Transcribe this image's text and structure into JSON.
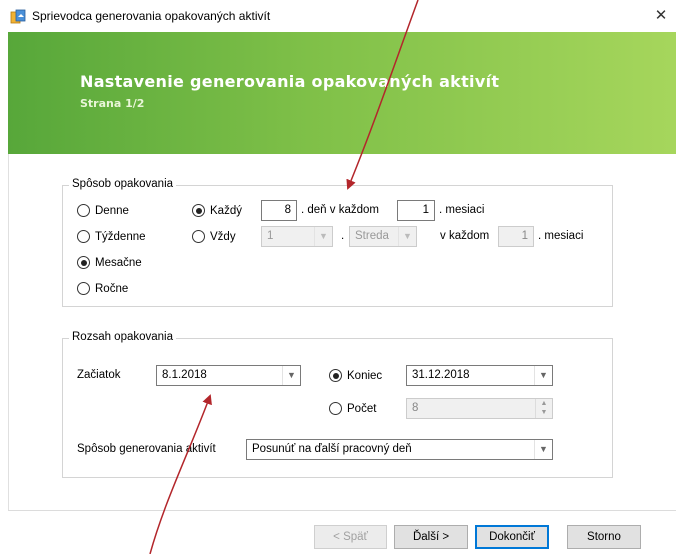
{
  "window": {
    "title": "Sprievodca generovania opakovaných aktivít",
    "close_symbol": "✕"
  },
  "banner": {
    "title": "Nastavenie generovania opakovaných aktivít",
    "subtitle": "Strana 1/2"
  },
  "repeat_mode": {
    "legend": "Spôsob opakovania",
    "options": [
      {
        "label": "Denne",
        "selected": false
      },
      {
        "label": "Týždenne",
        "selected": false
      },
      {
        "label": "Mesačne",
        "selected": true
      },
      {
        "label": "Ročne",
        "selected": false
      }
    ],
    "each": {
      "label": "Každý",
      "selected": true,
      "day_value": "8",
      "day_text": ". deň v každom",
      "month_value": "1",
      "month_text": ". mesiaci"
    },
    "always": {
      "label": "Vždy",
      "selected": false,
      "order_value": "1",
      "dot": ".",
      "weekday_value": "Streda",
      "in_each_text": "v každom",
      "month_value": "1",
      "month_text": ". mesiaci"
    }
  },
  "range": {
    "legend": "Rozsah opakovania",
    "start_label": "Začiatok",
    "start_value": "8.1.2018",
    "end": {
      "label": "Koniec",
      "selected": true,
      "value": "31.12.2018"
    },
    "count": {
      "label": "Počet",
      "selected": false,
      "value": "8"
    },
    "generation_label": "Spôsob generovania aktivít",
    "generation_value": "Posunúť na ďalší pracovný deň"
  },
  "footer": {
    "back": "< Späť",
    "next": "Ďalší >",
    "finish": "Dokončiť",
    "cancel": "Storno"
  },
  "colors": {
    "banner_start": "#57a73a",
    "banner_end": "#a6d65c",
    "annotation_arrow": "#b3262b",
    "default_button_border": "#0078d7"
  }
}
